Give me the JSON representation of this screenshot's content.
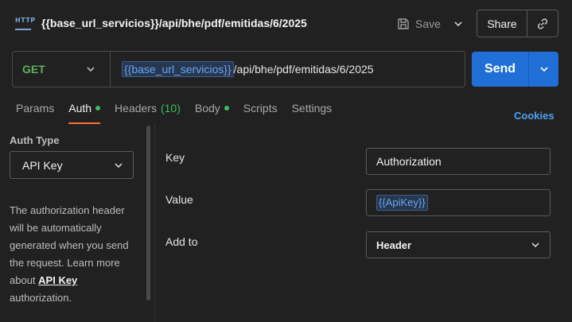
{
  "title_bar": {
    "icon_text": "HTTP",
    "request_name": "{{base_url_servicios}}/api/bhe/pdf/emitidas/6/2025",
    "save_label": "Save",
    "share_label": "Share"
  },
  "request": {
    "method": "GET",
    "url_variable": "{{base_url_servicios}}",
    "url_path": "/api/bhe/pdf/emitidas/6/2025",
    "send_label": "Send"
  },
  "tabs": [
    {
      "label": "Params"
    },
    {
      "label": "Auth",
      "active": true,
      "dot": true
    },
    {
      "label": "Headers",
      "count": "(10)"
    },
    {
      "label": "Body",
      "dot": true
    },
    {
      "label": "Scripts"
    },
    {
      "label": "Settings"
    }
  ],
  "cookies_label": "Cookies",
  "auth": {
    "type_label": "Auth Type",
    "type_value": "API Key",
    "description_pre": "The authorization header will be automatically generated when you send the request. Learn more about ",
    "description_link": "API Key",
    "description_post": " authorization."
  },
  "form": {
    "key_label": "Key",
    "key_value": "Authorization",
    "value_label": "Value",
    "value_value": "{{ApiKey}}",
    "add_to_label": "Add to",
    "add_to_value": "Header"
  },
  "colors": {
    "accent": "#ff6c37",
    "send": "#1f6fd6",
    "method_get": "#5fb060",
    "variable": "#6aa6f0",
    "active_dot": "#3dbd5c"
  }
}
